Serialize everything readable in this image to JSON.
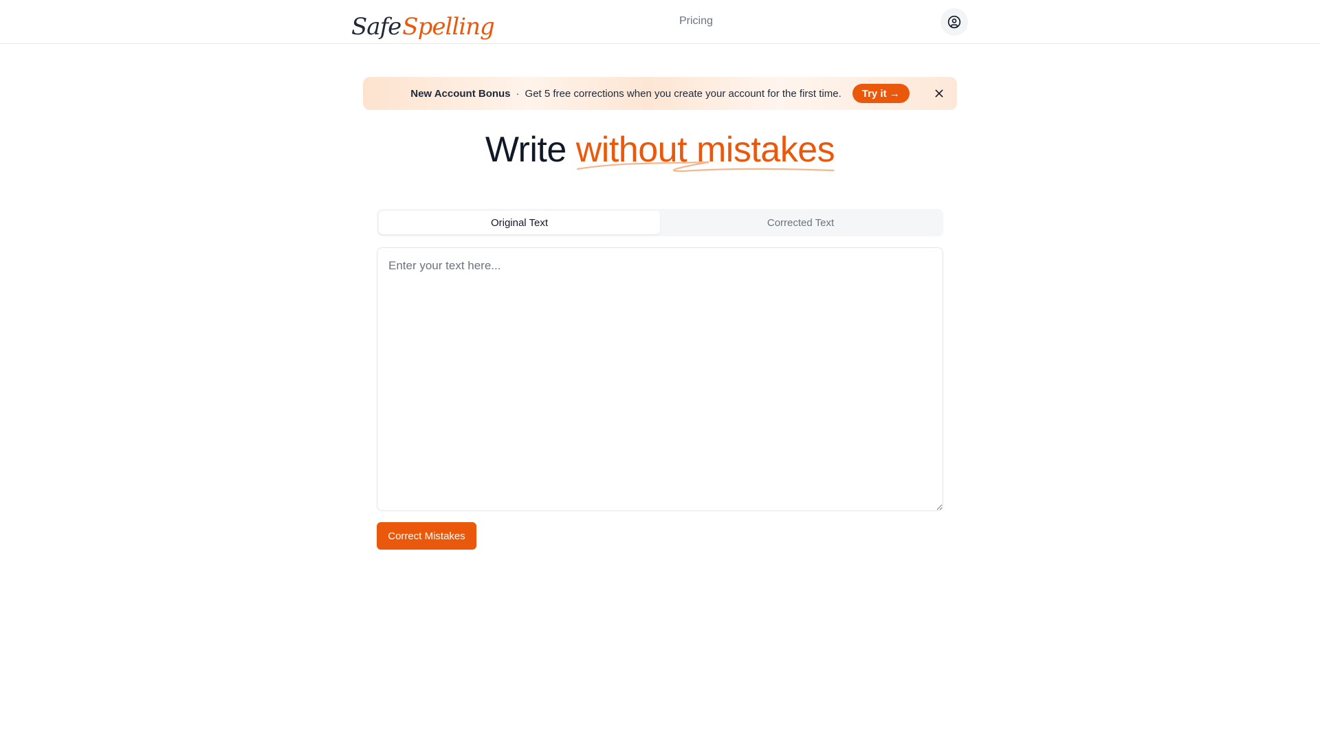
{
  "header": {
    "logo": {
      "part1": "Safe",
      "part2": "Spelling"
    },
    "nav": {
      "pricing": "Pricing"
    },
    "user_icon": "user-circle-icon"
  },
  "banner": {
    "title": "New Account Bonus",
    "separator": "·",
    "message": "Get 5 free corrections when you create your account for the first time.",
    "cta": "Try it →",
    "close_icon": "close-icon"
  },
  "hero": {
    "word1": "Write",
    "highlight": "without mistakes"
  },
  "tabs": [
    {
      "label": "Original Text",
      "active": true
    },
    {
      "label": "Corrected Text",
      "active": false
    }
  ],
  "editor": {
    "value": "",
    "placeholder": "Enter your text here..."
  },
  "actions": {
    "correct": "Correct Mistakes"
  },
  "colors": {
    "accent": "#ea580c",
    "text": "#111827",
    "muted": "#6b7280"
  }
}
